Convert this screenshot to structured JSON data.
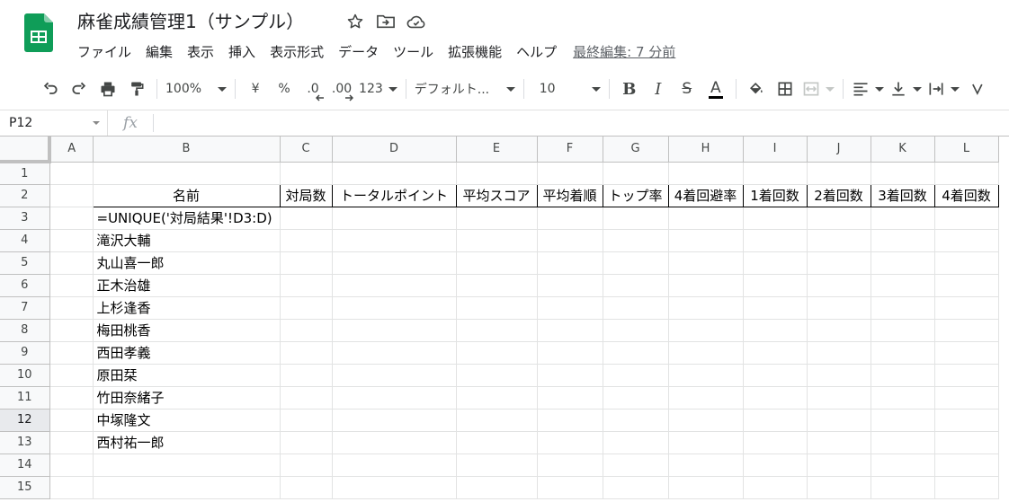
{
  "app": {
    "title": "麻雀成績管理1（サンプル）",
    "last_edit": "最終編集: 7 分前",
    "brand_color": "#0f9d58"
  },
  "title_icons": [
    "star-icon",
    "move-to-folder-icon",
    "cloud-saved-icon"
  ],
  "menu": [
    "ファイル",
    "編集",
    "表示",
    "挿入",
    "表示形式",
    "データ",
    "ツール",
    "拡張機能",
    "ヘルプ"
  ],
  "toolbar": {
    "zoom": "100%",
    "currency": "¥",
    "percent": "%",
    "decrease_decimal": ".0",
    "increase_decimal": ".00",
    "more_formats": "123",
    "font": "デフォルト...",
    "font_size": "10",
    "bold": "B",
    "italic": "I",
    "strike": "S",
    "text_color": "A"
  },
  "formula_bar": {
    "cell_ref": "P12",
    "fx": "fx",
    "value": ""
  },
  "grid": {
    "columns": [
      "A",
      "B",
      "C",
      "D",
      "E",
      "F",
      "G",
      "H",
      "I",
      "J",
      "K",
      "L"
    ],
    "rows": [
      "1",
      "2",
      "3",
      "4",
      "5",
      "6",
      "7",
      "8",
      "9",
      "10",
      "11",
      "12",
      "13",
      "14",
      "15"
    ],
    "active_row": "12",
    "headers": [
      "名前",
      "対局数",
      "トータルポイント",
      "平均スコア",
      "平均着順",
      "トップ率",
      "4着回避率",
      "1着回数",
      "2着回数",
      "3着回数",
      "4着回数"
    ],
    "formula_cell": "=UNIQUE('対局結果'!D3:D)",
    "names": [
      "滝沢大輔",
      "丸山喜一郎",
      "正木治雄",
      "上杉逢香",
      "梅田桃香",
      "西田孝義",
      "原田栞",
      "竹田奈緒子",
      "中塚隆文",
      "西村祐一郎"
    ]
  }
}
